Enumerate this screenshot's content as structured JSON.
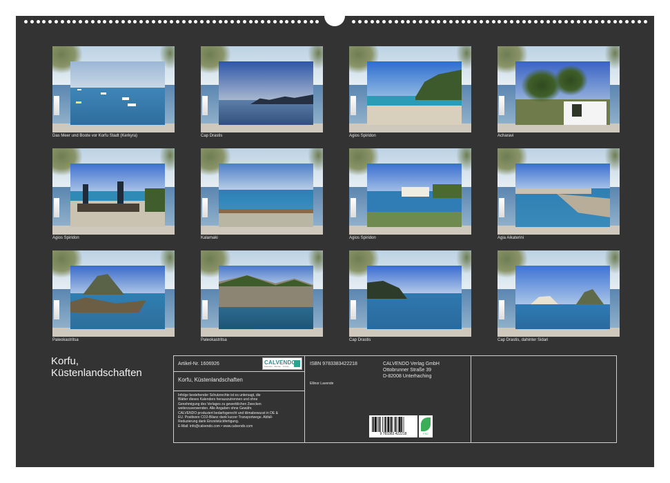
{
  "calendar": {
    "title_line1": "Korfu,",
    "title_line2": "Küstenlandschaften"
  },
  "photos": [
    {
      "caption": "Das Meer und Boote vor Korfu Stadt (Kerkyra)",
      "scene": "bay-with-sailboats"
    },
    {
      "caption": "Cap Drastis",
      "scene": "misty-sea-rocks"
    },
    {
      "caption": "Agios Spiridon",
      "scene": "green-headland-beach"
    },
    {
      "caption": "Acharavi",
      "scene": "palm-garden-gate"
    },
    {
      "caption": "Agios Spiridon",
      "scene": "beach-umbrellas-tables"
    },
    {
      "caption": "Kalamaki",
      "scene": "beach-fence-sea"
    },
    {
      "caption": "Agios Spiridon",
      "scene": "house-on-coast"
    },
    {
      "caption": "Agia Aikaterini",
      "scene": "lagoon-rocks"
    },
    {
      "caption": "Paleokastritsa",
      "scene": "rocky-bay"
    },
    {
      "caption": "Paleokastritsa",
      "scene": "green-cliffs"
    },
    {
      "caption": "Cap Drastis",
      "scene": "rock-island-sea"
    },
    {
      "caption": "Cap Drastis, dahinter Sidari",
      "scene": "white-cliffs-sea"
    }
  ],
  "info": {
    "article": "Artikel-Nr. 1606926",
    "subtitle": "Korfu, Küstenlandschaften",
    "legal": [
      "Infolge bestehender Schutzrechte ist es untersagt, die",
      "Blätter dieses Kalenders herauszutrennen und ohne",
      "Genehmigung des Verlages zu gewerblichen Zwecken",
      "weiterzuverwenden. Alle Angaben ohne Gewähr.",
      "CALVENDO produziert bedarfsgerecht und klimabewusst in DE &",
      "EU. Positivere CO2-Bilanz dank kurzer Transportwege. Abfall-",
      "Reduzierung dank Einzelstückfertigung.",
      "E-Mail: info@calvendo.com • www.calvendo.com"
    ],
    "isbn": "ISBN 9783383422218",
    "author": "Ellinor Lavende",
    "publisher": [
      "CALVENDO Verlag GmbH",
      "Ottobrunner Straße 39",
      "D-82008 Unterhaching"
    ],
    "logo_text": "CALVENDO",
    "logo_sub": "Kalender · Bücher · Puzzle",
    "barcode_number": "9 783383 422218",
    "eco_label": "FSC"
  }
}
